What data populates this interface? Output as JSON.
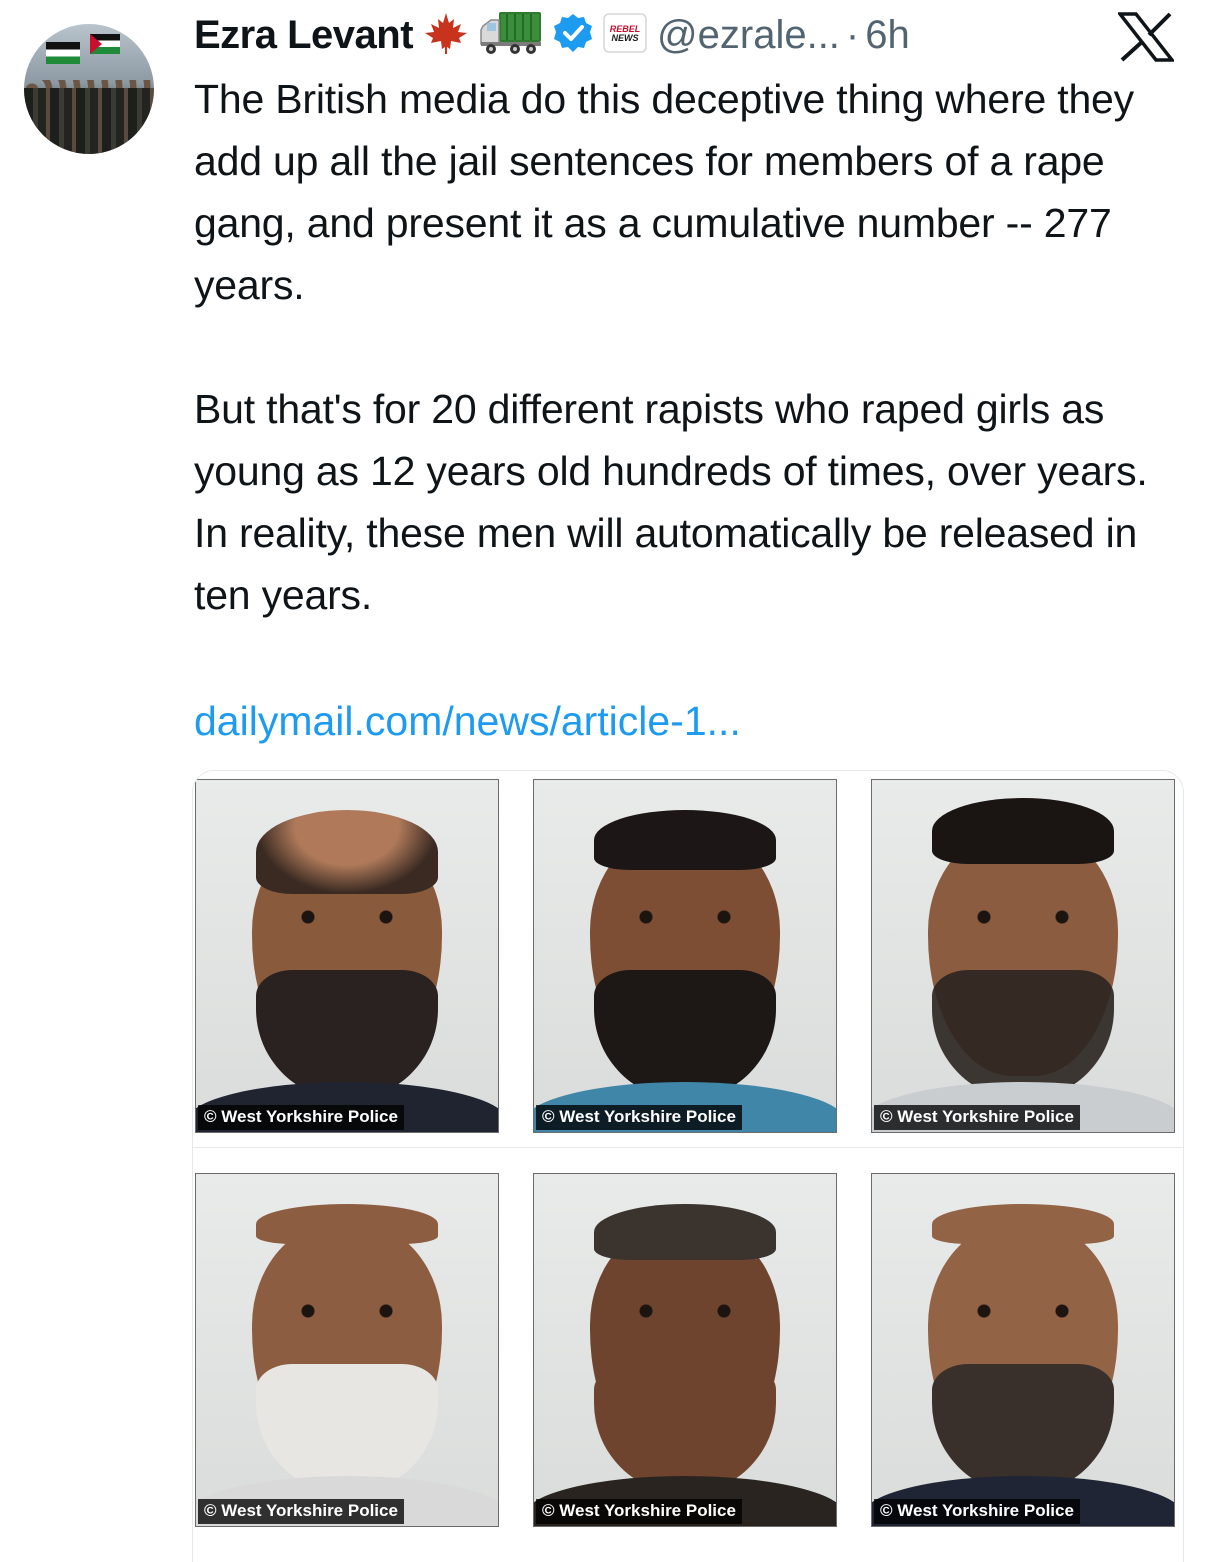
{
  "author": {
    "name": "Ezra Levant",
    "handle": "@ezrale...",
    "separator": "·",
    "time": "6h"
  },
  "icons": {
    "badges": [
      "maple-leaf-icon",
      "truck-icon",
      "verified-icon",
      "rebel-news-icon"
    ],
    "close": "x-logo-icon"
  },
  "rebel_badge": {
    "line1": "REBEL",
    "line2": "NEWS"
  },
  "tweet": {
    "paragraph1": "The British media do this deceptive thing where they add up all the jail sentences for members of a rape gang, and present it as a cumulative number -- 277 years.",
    "paragraph2": "But that's for 20 different rapists who raped girls as young as 12 years old hundreds of times, over years. In reality, these men will automatically be released in ten years.",
    "link": "dailymail.com/news/article-1..."
  },
  "media": {
    "photos": [
      {
        "credit": "© West Yorkshire Police"
      },
      {
        "credit": "© West Yorkshire Police"
      },
      {
        "credit": "© West Yorkshire Police"
      },
      {
        "credit": "© West Yorkshire Police"
      },
      {
        "credit": "© West Yorkshire Police"
      },
      {
        "credit": "© West Yorkshire Police"
      }
    ]
  },
  "colors": {
    "text": "#0f1419",
    "secondary": "#536471",
    "link": "#1d9bf0",
    "verified": "#1d9bf0"
  }
}
